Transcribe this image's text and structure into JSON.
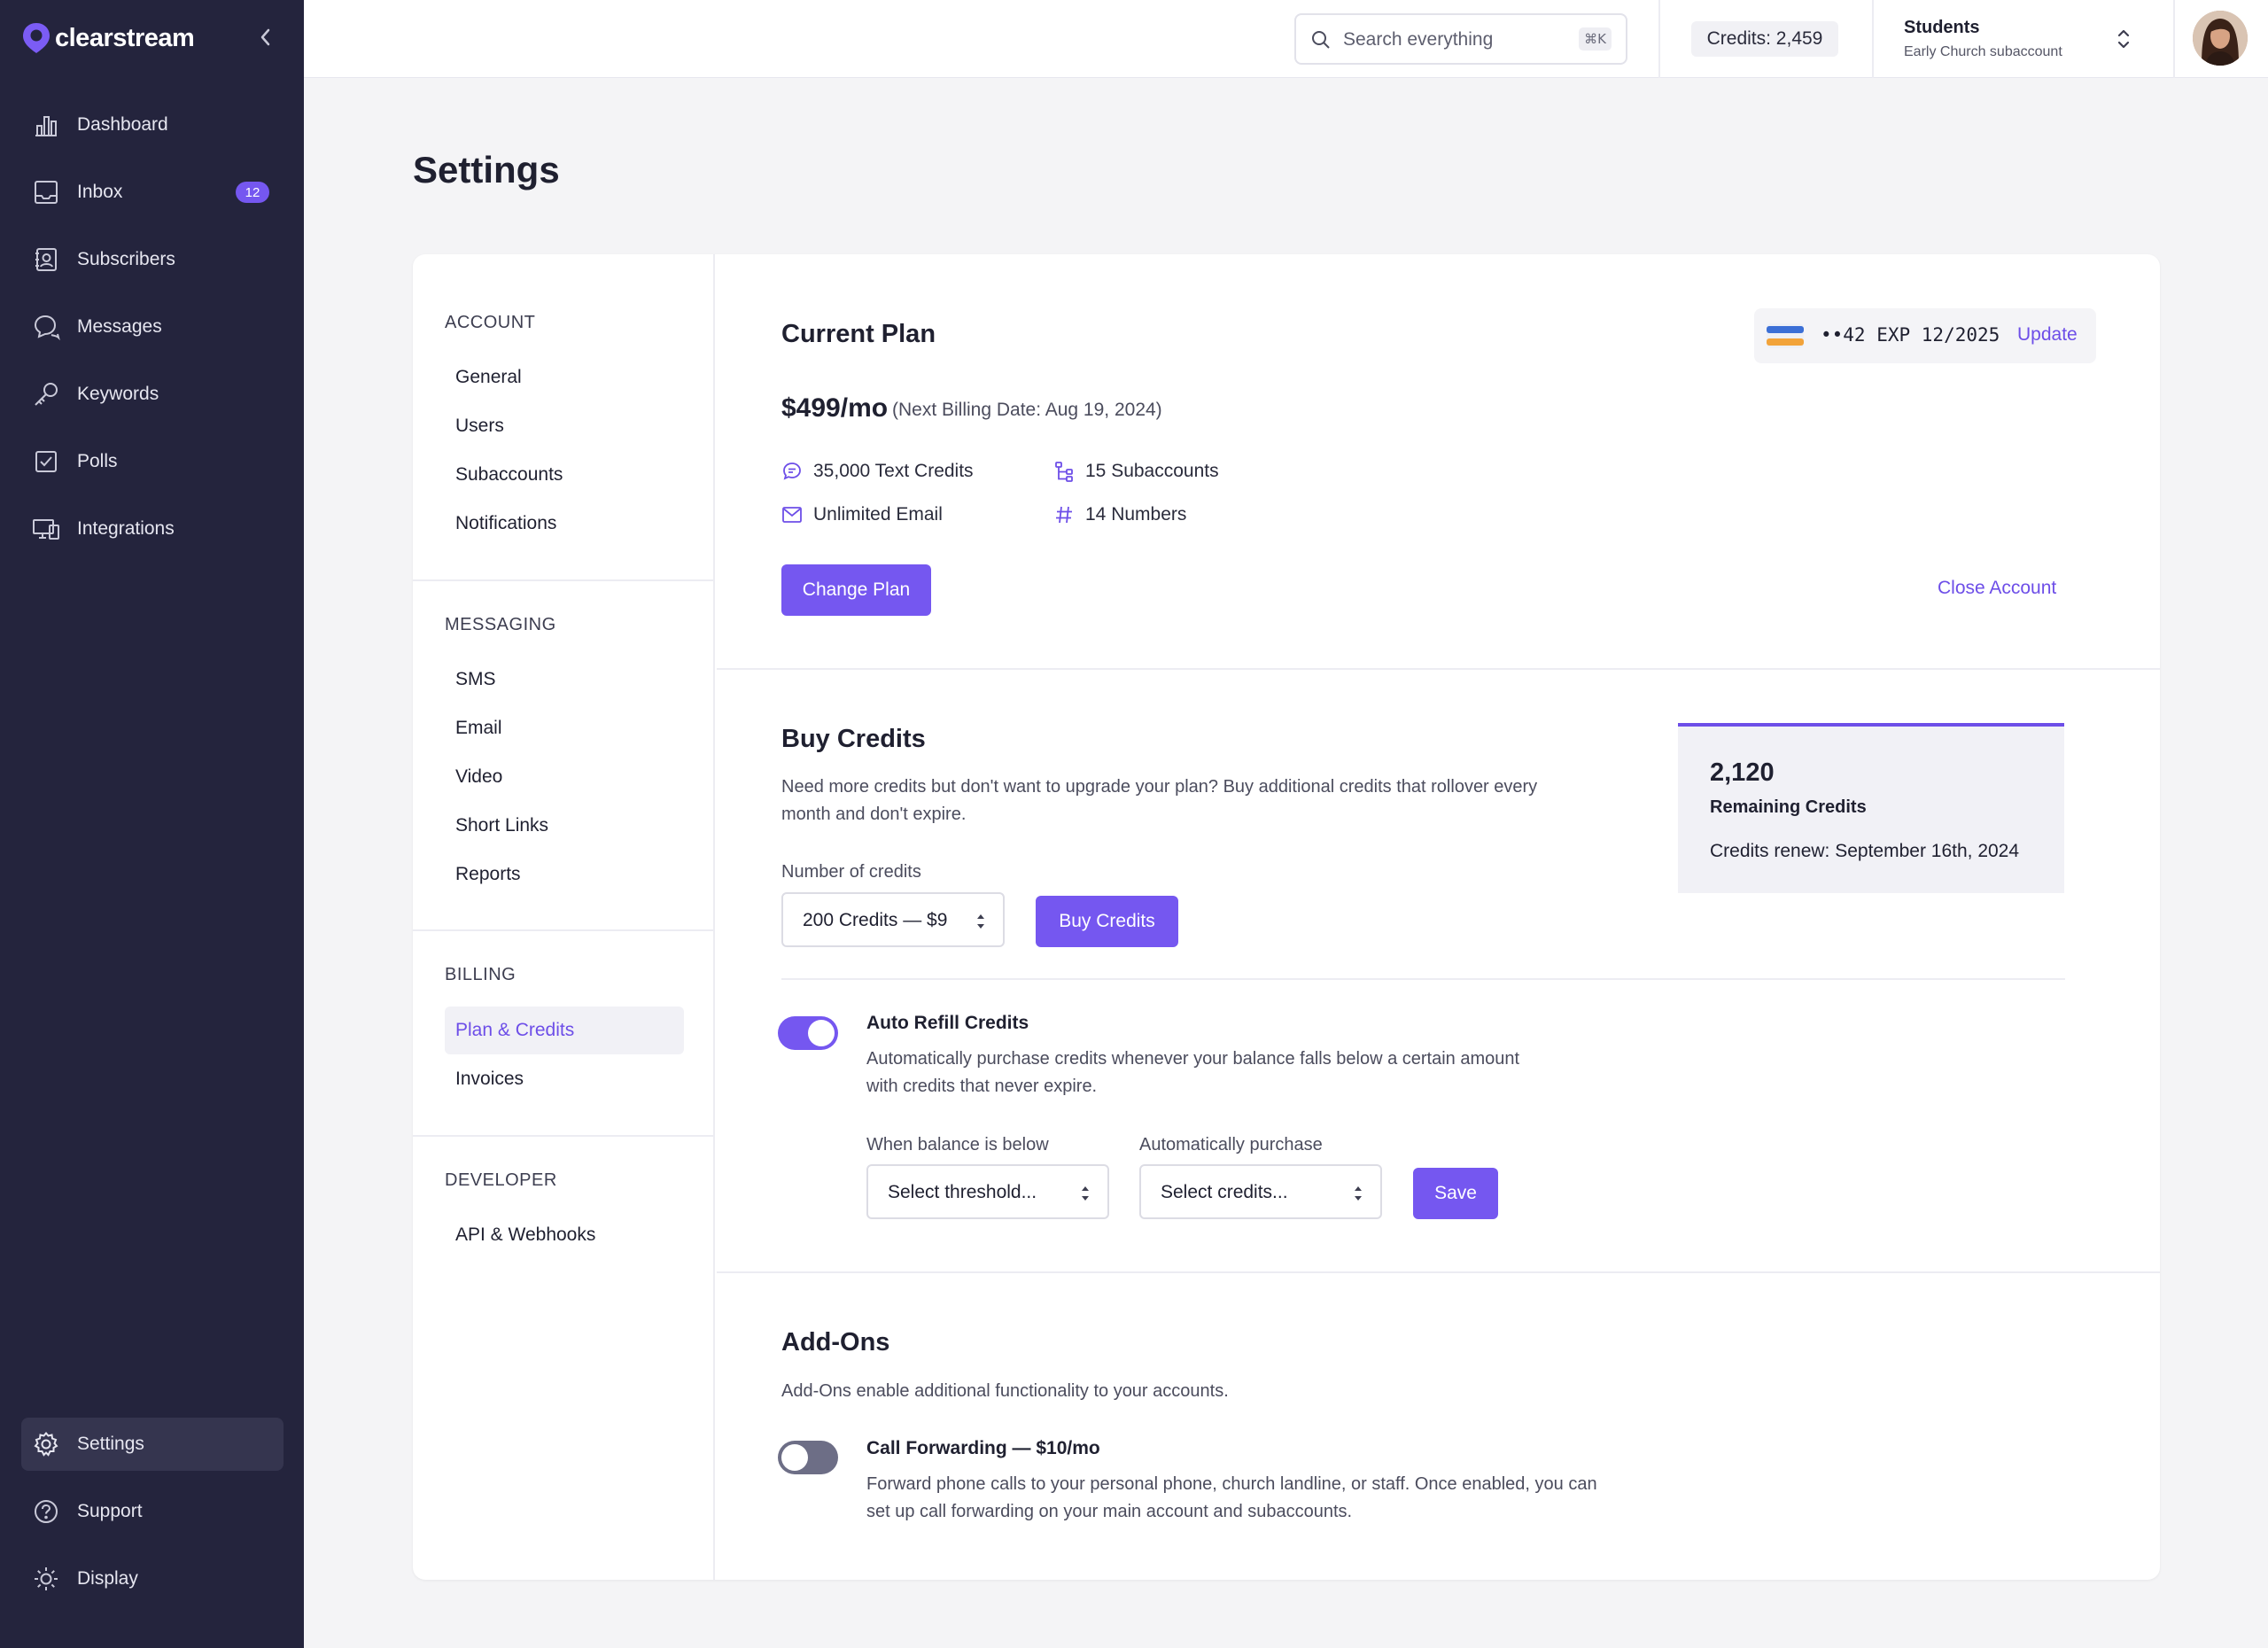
{
  "brand": {
    "name": "clearstream"
  },
  "sidebar": {
    "items": [
      {
        "label": "Dashboard",
        "icon": "bar-chart-icon"
      },
      {
        "label": "Inbox",
        "icon": "inbox-icon",
        "badge": "12"
      },
      {
        "label": "Subscribers",
        "icon": "contacts-icon"
      },
      {
        "label": "Messages",
        "icon": "chat-icon"
      },
      {
        "label": "Keywords",
        "icon": "key-icon"
      },
      {
        "label": "Polls",
        "icon": "checkbox-icon"
      },
      {
        "label": "Integrations",
        "icon": "devices-icon"
      }
    ],
    "bottom": [
      {
        "label": "Settings",
        "icon": "gear-icon",
        "active": true
      },
      {
        "label": "Support",
        "icon": "help-icon"
      },
      {
        "label": "Display",
        "icon": "sun-icon"
      }
    ]
  },
  "topbar": {
    "search_placeholder": "Search everything",
    "shortcut": "⌘K",
    "credits": "Credits: 2,459",
    "account_name": "Students",
    "account_sub": "Early Church subaccount"
  },
  "page": {
    "title": "Settings"
  },
  "settings_nav": {
    "sections": [
      {
        "heading": "ACCOUNT",
        "items": [
          "General",
          "Users",
          "Subaccounts",
          "Notifications"
        ]
      },
      {
        "heading": "MESSAGING",
        "items": [
          "SMS",
          "Email",
          "Video",
          "Short Links",
          "Reports"
        ]
      },
      {
        "heading": "BILLING",
        "items": [
          "Plan & Credits",
          "Invoices"
        ]
      },
      {
        "heading": "DEVELOPER",
        "items": [
          "API & Webhooks"
        ]
      }
    ],
    "active": "Plan & Credits"
  },
  "current_plan": {
    "title": "Current Plan",
    "card_number": "••42 EXP 12/2025",
    "update_label": "Update",
    "price": "$499/mo",
    "billing_date": "(Next Billing Date: Aug 19, 2024)",
    "features": [
      "35,000 Text Credits",
      "15 Subaccounts",
      "Unlimited Email",
      "14 Numbers"
    ],
    "change_plan_label": "Change Plan",
    "close_account_label": "Close Account"
  },
  "buy_credits": {
    "title": "Buy Credits",
    "description_line1": "Need more credits but don't want to upgrade your plan? Buy additional credits that rollover every",
    "description_line2": "month and don't expire.",
    "number_label": "Number of credits",
    "selected": "200 Credits — $9",
    "button_label": "Buy Credits",
    "remaining_value": "2,120",
    "remaining_label": "Remaining Credits",
    "renew_text": "Credits renew: September 16th, 2024"
  },
  "auto_refill": {
    "title": "Auto Refill Credits",
    "enabled": true,
    "description_line1": "Automatically purchase credits whenever your balance falls below a certain amount",
    "description_line2": "with credits that never expire.",
    "threshold_label": "When balance is below",
    "threshold_placeholder": "Select threshold...",
    "purchase_label": "Automatically purchase",
    "purchase_placeholder": "Select credits...",
    "save_label": "Save"
  },
  "addons": {
    "title": "Add-Ons",
    "description": "Add-Ons enable additional functionality to your accounts.",
    "items": [
      {
        "title": "Call Forwarding — $10/mo",
        "enabled": false,
        "description_line1": "Forward phone calls to your personal phone, church landline, or staff. Once enabled, you can",
        "description_line2": "set up call forwarding on your main account and subaccounts."
      }
    ]
  },
  "colors": {
    "accent": "#7557f0",
    "sidebar_bg": "#24243d",
    "page_bg": "#f4f4f6"
  }
}
